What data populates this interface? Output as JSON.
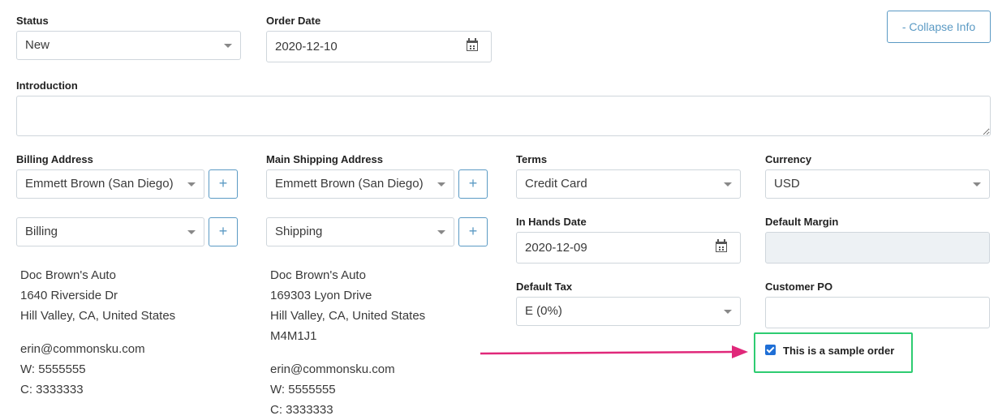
{
  "status": {
    "label": "Status",
    "value": "New"
  },
  "order_date": {
    "label": "Order Date",
    "value": "2020-12-10"
  },
  "collapse_button": "- Collapse Info",
  "introduction": {
    "label": "Introduction",
    "value": ""
  },
  "billing": {
    "label": "Billing Address",
    "contact": "Emmett Brown (San Diego)",
    "address_type": "Billing",
    "add_label": "+",
    "address_lines": [
      "Doc Brown's Auto",
      "1640 Riverside Dr",
      "Hill Valley, CA, United States"
    ],
    "contact_lines": [
      "erin@commonsku.com",
      "W: 5555555",
      "C: 3333333"
    ]
  },
  "shipping": {
    "label": "Main Shipping Address",
    "contact": "Emmett Brown (San Diego)",
    "address_type": "Shipping",
    "add_label": "+",
    "address_lines": [
      "Doc Brown's Auto",
      "169303 Lyon Drive",
      "Hill Valley, CA, United States",
      "M4M1J1"
    ],
    "contact_lines": [
      "erin@commonsku.com",
      "W: 5555555",
      "C: 3333333"
    ]
  },
  "terms": {
    "label": "Terms",
    "value": "Credit Card"
  },
  "currency": {
    "label": "Currency",
    "value": "USD"
  },
  "in_hands_date": {
    "label": "In Hands Date",
    "value": "2020-12-09"
  },
  "default_margin": {
    "label": "Default Margin",
    "value": ""
  },
  "default_tax": {
    "label": "Default Tax",
    "value": "E (0%)"
  },
  "customer_po": {
    "label": "Customer PO",
    "value": ""
  },
  "sample_order": {
    "label": "This is a sample order",
    "checked": true
  },
  "colors": {
    "accent": "#5b9ac4",
    "highlight_box": "#2ecc71",
    "arrow": "#e0287a",
    "checkbox": "#1f6fd6"
  }
}
